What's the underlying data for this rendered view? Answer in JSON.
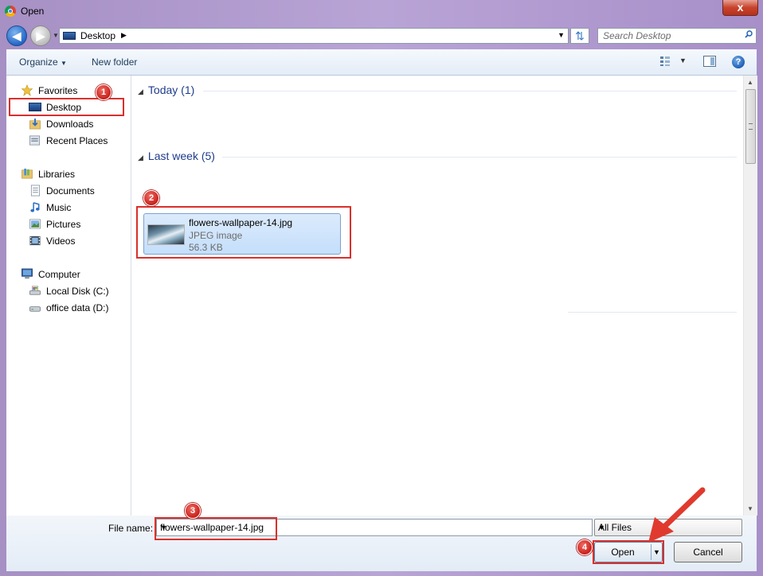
{
  "window": {
    "title": "Open",
    "close_glyph": "x",
    "app_icon": "chrome-icon"
  },
  "nav": {
    "address_crumb": "Desktop",
    "search_placeholder": "Search Desktop"
  },
  "toolbar": {
    "organize_label": "Organize",
    "new_folder_label": "New folder"
  },
  "sidebar": {
    "groups": [
      {
        "label": "Favorites",
        "icon": "star-icon",
        "items": [
          {
            "label": "Desktop",
            "icon": "desktop-icon"
          },
          {
            "label": "Downloads",
            "icon": "downloads-icon"
          },
          {
            "label": "Recent Places",
            "icon": "recent-places-icon"
          }
        ]
      },
      {
        "label": "Libraries",
        "icon": "libraries-icon",
        "items": [
          {
            "label": "Documents",
            "icon": "documents-icon"
          },
          {
            "label": "Music",
            "icon": "music-icon"
          },
          {
            "label": "Pictures",
            "icon": "pictures-icon"
          },
          {
            "label": "Videos",
            "icon": "videos-icon"
          }
        ]
      },
      {
        "label": "Computer",
        "icon": "computer-icon",
        "items": [
          {
            "label": "Local Disk (C:)",
            "icon": "local-disk-icon"
          },
          {
            "label": "office data (D:)",
            "icon": "drive-icon"
          }
        ]
      }
    ]
  },
  "content": {
    "groups": [
      {
        "header": "Today (1)"
      },
      {
        "header": "Last week (5)"
      }
    ],
    "file": {
      "name": "flowers-wallpaper-14.jpg",
      "type": "JPEG image",
      "size": "56.3 KB"
    }
  },
  "footer": {
    "file_name_label": "File name:",
    "file_name_value": "flowers-wallpaper-14.jpg",
    "filter_value": "All Files",
    "open_label": "Open",
    "cancel_label": "Cancel"
  },
  "annotations": {
    "badges": [
      "1",
      "2",
      "3",
      "4"
    ],
    "color": "#d9302c"
  }
}
